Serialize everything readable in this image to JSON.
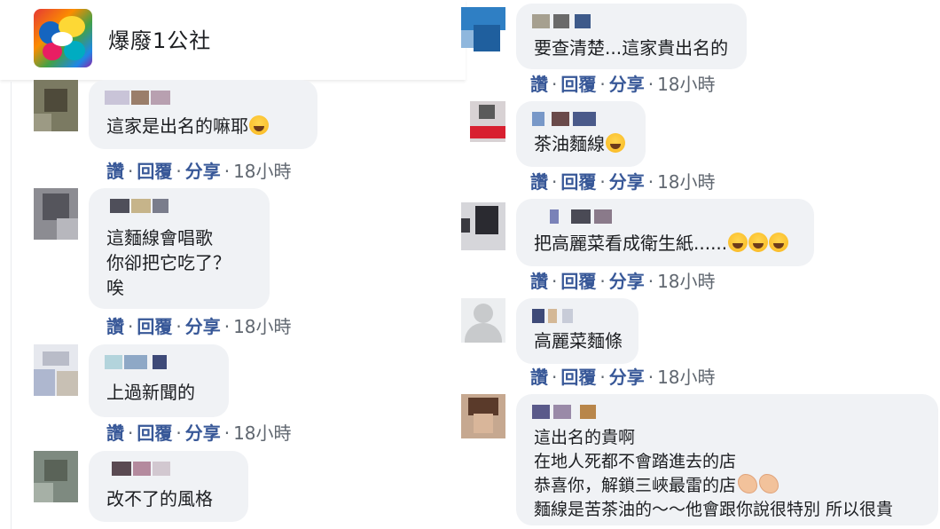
{
  "page": {
    "name": "爆廢1公社"
  },
  "colors": {
    "bubble": "#f0f2f5",
    "link": "#385898",
    "meta": "#606770"
  },
  "actions": {
    "like": "讚",
    "reply": "回覆",
    "share": "分享",
    "sep": "·"
  },
  "comments": [
    {
      "lines": [
        "這家是出名的嘛耶"
      ],
      "emoji": "laughing-tears",
      "time": "18小時"
    },
    {
      "lines": [
        "這麵線會唱歌",
        "你卻把它吃了？",
        "唉"
      ],
      "time": "18小時"
    },
    {
      "lines": [
        "上過新聞的"
      ],
      "time": "18小時"
    },
    {
      "lines": [
        "改不了的風格"
      ]
    },
    {
      "lines": [
        "要查清楚...這家貴出名的"
      ],
      "time": "18小時"
    },
    {
      "lines": [
        "茶油麵線"
      ],
      "emoji": "grinning",
      "time": "18小時"
    },
    {
      "lines": [
        "把高麗菜看成衛生紙......"
      ],
      "emoji": "rofl x3",
      "time": "18小時"
    },
    {
      "lines": [
        "高麗菜麵條"
      ],
      "time": "18小時"
    },
    {
      "lines": [
        "這出名的貴啊",
        "在地人死都不會踏進去的店",
        "恭喜你，解鎖三峽最雷的店",
        "麵線是苦茶油的～～他會跟你說很特別 所以很貴"
      ],
      "emoji": "clapping x2"
    }
  ]
}
